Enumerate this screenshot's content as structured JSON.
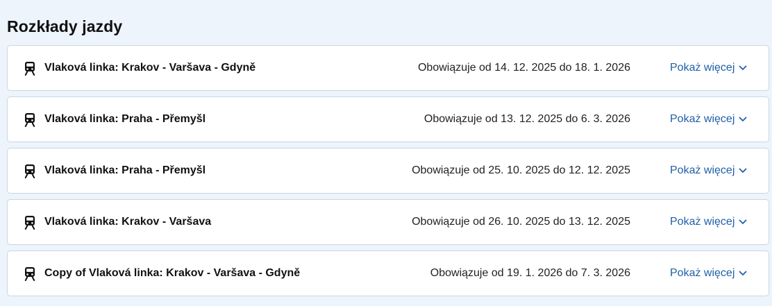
{
  "page": {
    "heading": "Rozkłady jazdy"
  },
  "colors": {
    "background": "#edf4fc",
    "card": "#ffffff",
    "border": "#c9d6e3",
    "link": "#1f5fa8"
  },
  "timetables": [
    {
      "icon": "train-icon",
      "title": "Vlaková linka: Krakov - Varšava - Gdyně",
      "validity": "Obowiązuje od 14. 12. 2025 do 18. 1. 2026",
      "more_label": "Pokaż więcej"
    },
    {
      "icon": "train-icon",
      "title": "Vlaková linka: Praha - Přemyšl",
      "validity": "Obowiązuje od 13. 12. 2025 do 6. 3. 2026",
      "more_label": "Pokaż więcej"
    },
    {
      "icon": "train-icon",
      "title": "Vlaková linka: Praha - Přemyšl",
      "validity": "Obowiązuje od 25. 10. 2025 do 12. 12. 2025",
      "more_label": "Pokaż więcej"
    },
    {
      "icon": "train-icon",
      "title": "Vlaková linka: Krakov - Varšava",
      "validity": "Obowiązuje od 26. 10. 2025 do 13. 12. 2025",
      "more_label": "Pokaż więcej"
    },
    {
      "icon": "train-icon",
      "title": "Copy of Vlaková linka: Krakov - Varšava - Gdyně",
      "validity": "Obowiązuje od 19. 1. 2026 do 7. 3. 2026",
      "more_label": "Pokaż więcej"
    }
  ]
}
